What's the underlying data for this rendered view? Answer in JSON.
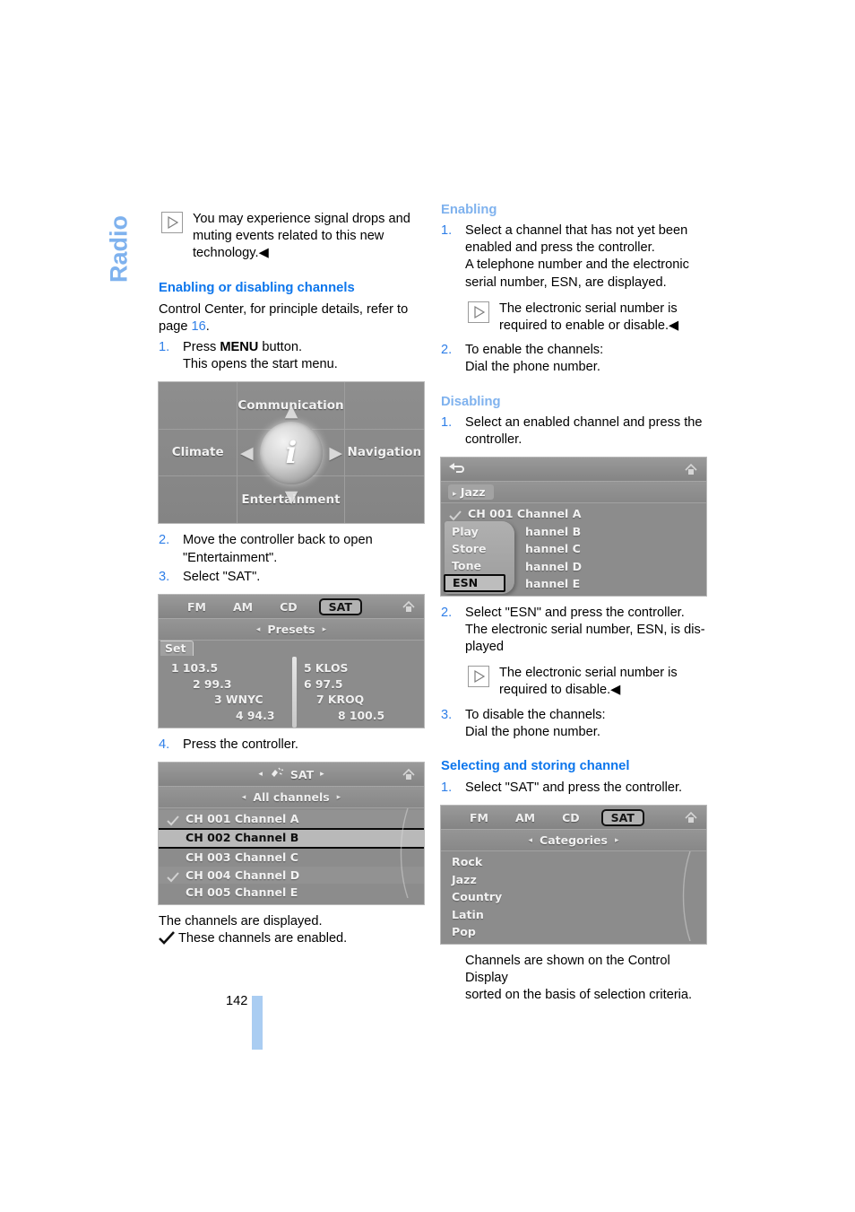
{
  "chapter": {
    "title": "Radio"
  },
  "page": {
    "number": "142"
  },
  "left_column": {
    "intro_note": {
      "icon": "note-triangle-icon",
      "text": "You may experience signal drops and muting events related to this new technology.",
      "end_marker": "◀"
    },
    "heading": "Enabling or disabling channels",
    "intro_text_pre": "Control Center, for principle details, refer to page ",
    "intro_page_link": "16",
    "intro_text_post": ".",
    "steps": [
      {
        "num": "1.",
        "pre": "Press ",
        "bold": "MENU",
        "post": " button.",
        "second_line": "This opens the start menu."
      },
      {
        "num": "2.",
        "text": "Move the controller back to open \"Entertainment\"."
      },
      {
        "num": "3.",
        "text": "Select \"SAT\"."
      },
      {
        "num": "4.",
        "text": "Press the controller."
      }
    ],
    "closing_line_1": "The channels are displayed.",
    "closing_line_2": "These channels are enabled."
  },
  "start_menu_screen": {
    "cells": [
      "",
      "Communication",
      "",
      "Climate",
      "",
      "Navigation",
      "",
      "Entertainment",
      ""
    ],
    "center_glyph": "i",
    "arrows": {
      "up": "▲",
      "down": "▼",
      "left": "◀",
      "right": "▶"
    }
  },
  "presets_screen": {
    "tabs": [
      "FM",
      "AM",
      "CD",
      "SAT"
    ],
    "selected_tab": "SAT",
    "subtitle": "Presets",
    "arrow_left": "◂",
    "arrow_right": "▸",
    "set_button": "Set",
    "presets_left": [
      "1 103.5",
      "2 99.3",
      "3 WNYC",
      "4 94.3"
    ],
    "presets_right": [
      "5 KLOS",
      "6 97.5",
      "7 KROQ",
      "8 100.5"
    ],
    "home_icon": "home-icon"
  },
  "all_channels_screen": {
    "title": "SAT",
    "arrow_left": "◂",
    "arrow_right": "▸",
    "subtitle": "All channels",
    "home_icon": "home-icon",
    "rows": [
      {
        "label": "CH 001 Channel A",
        "checked": true,
        "selected": false
      },
      {
        "label": "CH 002 Channel B",
        "checked": false,
        "selected": true
      },
      {
        "label": "CH 003 Channel C",
        "checked": false,
        "selected": false
      },
      {
        "label": "CH 004 Channel D",
        "checked": true,
        "selected": false
      },
      {
        "label": "CH 005 Channel E",
        "checked": false,
        "selected": false
      }
    ]
  },
  "right_column": {
    "enabling": {
      "heading": "Enabling",
      "steps": [
        {
          "num": "1.",
          "lines": [
            "Select a channel that has not yet been",
            "enabled and press the controller.",
            "A telephone number and the electronic",
            "serial number, ESN, are displayed."
          ]
        },
        {
          "num": "2.",
          "lines": [
            "To enable the channels:",
            "Dial the phone number."
          ]
        }
      ],
      "note": {
        "icon": "note-triangle-icon",
        "text": "The electronic serial number is required to enable or disable.",
        "end_marker": "◀"
      }
    },
    "disabling": {
      "heading": "Disabling",
      "step1": {
        "num": "1.",
        "lines": [
          "Select an enabled channel and press the",
          "controller."
        ]
      },
      "step2": {
        "num": "2.",
        "lines": [
          "Select \"ESN\" and press the controller.",
          "The electronic serial number, ESN, is dis-",
          "played"
        ]
      },
      "step3": {
        "num": "3.",
        "lines": [
          "To disable the channels:",
          "Dial the phone number."
        ]
      },
      "note": {
        "icon": "note-triangle-icon",
        "text": "The electronic serial number is required to disable.",
        "end_marker": "◀"
      }
    },
    "selecting": {
      "heading": "Selecting and storing channel",
      "step1": {
        "num": "1.",
        "text": "Select \"SAT\" and press the controller."
      },
      "closing": [
        "Channels are shown on the Control Display",
        "sorted on the basis of selection criteria."
      ]
    }
  },
  "esn_popup_screen": {
    "back_icon": "back-arrow-icon",
    "home_icon": "home-icon",
    "category_chip": "Jazz",
    "chip_arrow": "▸",
    "rows": [
      {
        "label": "CH 001 Channel A",
        "checked": true
      },
      {
        "label": "hannel B",
        "checked": false
      },
      {
        "label": "hannel C",
        "checked": false
      },
      {
        "label": "hannel D",
        "checked": false
      },
      {
        "label": "hannel E",
        "checked": false
      }
    ],
    "menu_items": [
      {
        "label": "Play",
        "selected": false
      },
      {
        "label": "Store",
        "selected": false
      },
      {
        "label": "Tone",
        "selected": false
      },
      {
        "label": "ESN",
        "selected": true
      }
    ]
  },
  "categories_screen": {
    "tabs": [
      "FM",
      "AM",
      "CD",
      "SAT"
    ],
    "selected_tab": "SAT",
    "subtitle": "Categories",
    "arrow_left": "◂",
    "arrow_right": "▸",
    "home_icon": "home-icon",
    "items": [
      "Rock",
      "Jazz",
      "Country",
      "Latin",
      "Pop"
    ]
  },
  "colors": {
    "heading_blue": "#0d76ec",
    "subheading_blue": "#7fb2ee",
    "step_number_blue": "#2f7fe8",
    "folio_bar_blue": "#aacdf2",
    "screen_gray": "#8c8c8c"
  }
}
